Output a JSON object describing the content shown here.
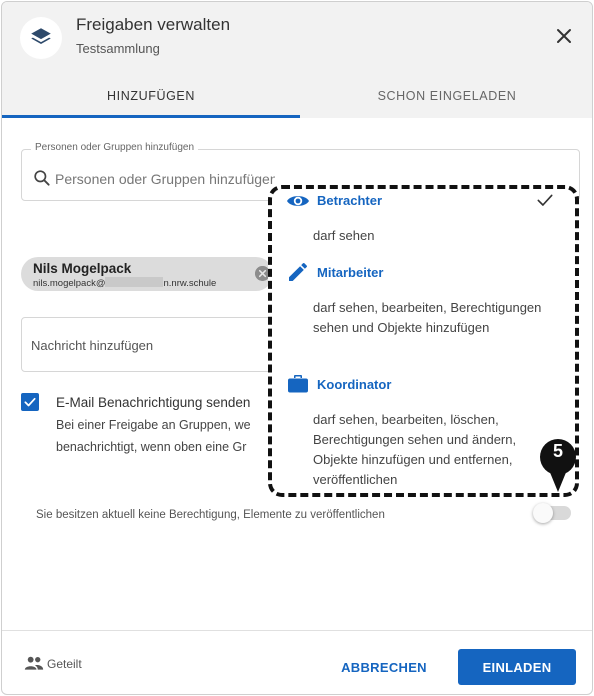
{
  "dialog": {
    "title": "Freigaben verwalten",
    "subtitle": "Testsammlung"
  },
  "tabs": [
    {
      "label": "HINZUFÜGEN",
      "active": true
    },
    {
      "label": "SCHON EINGELADEN",
      "active": false
    }
  ],
  "search": {
    "legend": "Personen oder Gruppen hinzufügen",
    "placeholder": "Personen oder Gruppen hinzufügen"
  },
  "recipient": {
    "name": "Nils Mogelpack",
    "email_start": "nils.mogelpack@",
    "email_end": "n.nrw.schule"
  },
  "message": {
    "placeholder": "Nachricht hinzufügen"
  },
  "notification": {
    "checked": true,
    "label": "E-Mail Benachrichtigung senden",
    "help_line1": "Bei einer Freigabe an Gruppen, we",
    "help_line2": "benachrichtigt, wenn oben eine Gr"
  },
  "publish": {
    "text": "Sie besitzen aktuell keine Berechtigung, Elemente zu veröffentlichen",
    "enabled": false
  },
  "roles": [
    {
      "name": "Betrachter",
      "icon": "eye-icon",
      "selected": true,
      "description": "darf sehen"
    },
    {
      "name": "Mitarbeiter",
      "icon": "pencil-icon",
      "selected": false,
      "description": "darf sehen, bearbeiten, Berechtigungen sehen und Objekte hinzufügen"
    },
    {
      "name": "Koordinator",
      "icon": "briefcase-icon",
      "selected": false,
      "description": "darf sehen, bearbeiten, löschen, Berechtigungen sehen und ändern, Objekte hinzufügen und entfernen, veröffentlichen"
    }
  ],
  "step_marker": "5",
  "footer": {
    "shared_label": "Geteilt",
    "cancel_label": "ABBRECHEN",
    "invite_label": "EINLADEN"
  },
  "colors": {
    "accent": "#1565c0",
    "header_bg": "#f2f2f2",
    "chip_bg": "#dcdcdc"
  }
}
